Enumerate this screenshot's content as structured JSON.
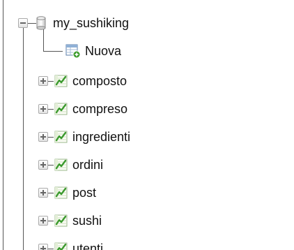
{
  "tree": {
    "database": {
      "name": "my_sushiking",
      "icon": "database-icon",
      "expanded": true
    },
    "new_item": {
      "label": "Nuova",
      "icon": "new-table-icon"
    },
    "tables": [
      {
        "label": "composto",
        "icon": "table-icon"
      },
      {
        "label": "compreso",
        "icon": "table-icon"
      },
      {
        "label": "ingredienti",
        "icon": "table-icon"
      },
      {
        "label": "ordini",
        "icon": "table-icon"
      },
      {
        "label": "post",
        "icon": "table-icon"
      },
      {
        "label": "sushi",
        "icon": "table-icon"
      },
      {
        "label": "utenti",
        "icon": "table-icon"
      }
    ],
    "colors": {
      "line": "#555555",
      "table_icon_green": "#3b9a2e",
      "text": "#111111"
    }
  }
}
